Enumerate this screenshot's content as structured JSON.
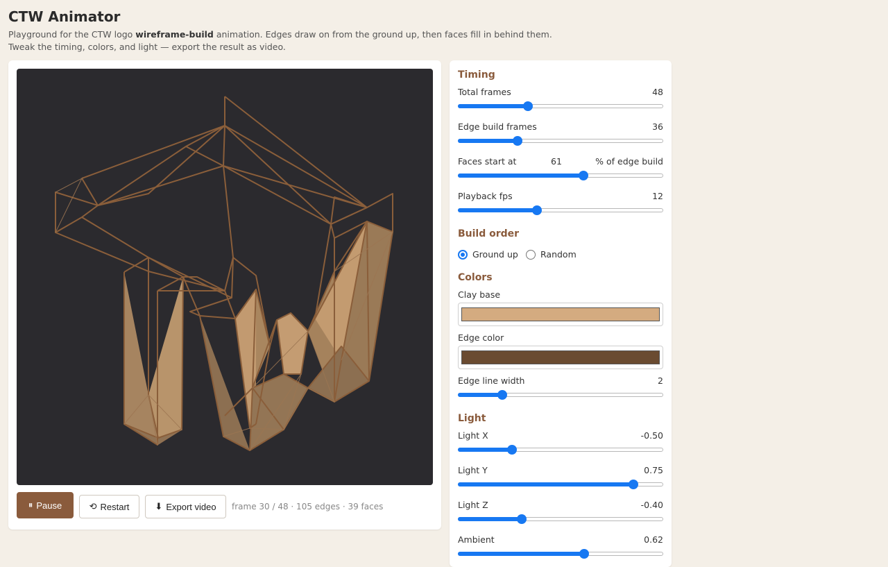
{
  "header": {
    "title": "CTW Animator",
    "desc_line1_pre": "Playground for the CTW logo ",
    "desc_line1_bold": "wireframe-build",
    "desc_line1_post": " animation. Edges draw on from the ground up, then faces fill in behind them.",
    "desc_line2": "Tweak the timing, colors, and light — export the result as video."
  },
  "playback": {
    "pause_label": "Pause",
    "restart_label": "Restart",
    "export_label": "Export video",
    "status": "frame 30 / 48 · 105 edges · 39 faces"
  },
  "timing": {
    "heading": "Timing",
    "total_frames": {
      "label": "Total frames",
      "value": "48",
      "fraction": 0.34
    },
    "edge_build": {
      "label": "Edge build frames",
      "value": "36",
      "fraction": 0.29
    },
    "faces_start": {
      "label": "Faces start at",
      "value": "61",
      "suffix": "% of edge build",
      "fraction": 0.61
    },
    "fps": {
      "label": "Playback fps",
      "value": "12",
      "fraction": 0.385
    }
  },
  "build_order": {
    "heading": "Build order",
    "options": [
      "Ground up",
      "Random"
    ],
    "selected": "Ground up"
  },
  "colors": {
    "heading": "Colors",
    "clay_label": "Clay base",
    "clay_color": "#d4ab80",
    "edge_label": "Edge color",
    "edge_color": "#6a4b31",
    "edge_width": {
      "label": "Edge line width",
      "value": "2",
      "fraction": 0.215
    }
  },
  "light": {
    "heading": "Light",
    "x": {
      "label": "Light X",
      "value": "-0.50",
      "fraction": 0.265
    },
    "y": {
      "label": "Light Y",
      "value": "0.75",
      "fraction": 0.855
    },
    "z": {
      "label": "Light Z",
      "value": "-0.40",
      "fraction": 0.31
    },
    "ambient": {
      "label": "Ambient",
      "value": "0.62",
      "fraction": 0.615
    }
  },
  "theme": {
    "accent": "#8a5b3c",
    "slider": "#1778f2",
    "stage_bg": "#2b2a2e",
    "wire": "#8a5e3a",
    "face": "#b38d63"
  }
}
